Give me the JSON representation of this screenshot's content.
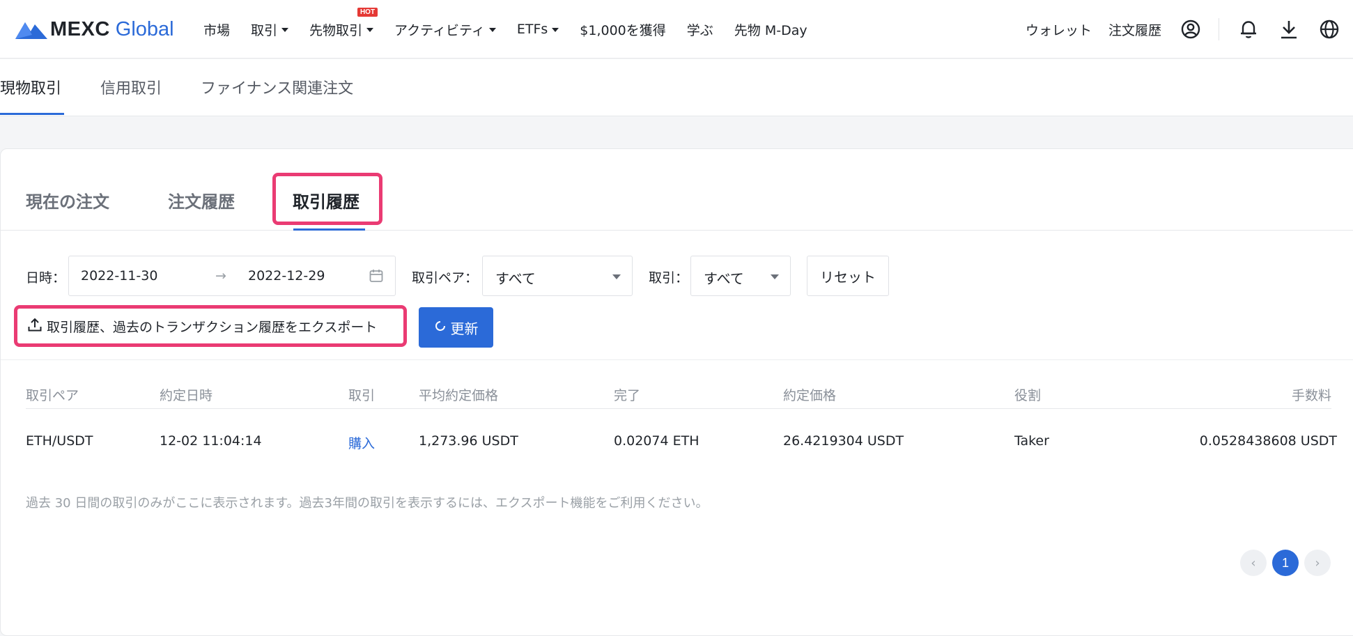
{
  "brand": {
    "name": "MEXC",
    "suffix": "Global"
  },
  "nav": {
    "items": [
      {
        "label": "市場"
      },
      {
        "label": "取引"
      },
      {
        "label": "先物取引",
        "badge": "HOT"
      },
      {
        "label": "アクティビティ"
      },
      {
        "label": "ETFs"
      },
      {
        "label": "$1,000を獲得"
      },
      {
        "label": "学ぶ"
      },
      {
        "label": "先物 M-Day"
      }
    ],
    "right": {
      "wallet": "ウォレット",
      "orders": "注文履歴"
    },
    "icons": [
      "user-icon",
      "bell-icon",
      "download-icon",
      "globe-icon"
    ]
  },
  "subtabs": [
    "現物取引",
    "信用取引",
    "ファイナンス関連注文"
  ],
  "tabs": [
    "現在の注文",
    "注文履歴",
    "取引履歴"
  ],
  "filters": {
    "date_label": "日時：",
    "date_from": "2022-11-30",
    "date_arrow": "→",
    "date_to": "2022-12-29",
    "pair_label": "取引ペア：",
    "pair_value": "すべて",
    "side_label": "取引：",
    "side_value": "すべて",
    "reset": "リセット"
  },
  "actions": {
    "export": "取引履歴、過去のトランザクション履歴をエクスポート",
    "refresh": "更新"
  },
  "table": {
    "headers": [
      "取引ペア",
      "約定日時",
      "取引",
      "平均約定価格",
      "完了",
      "約定価格",
      "役割",
      "手数料"
    ],
    "rows": [
      [
        "ETH/USDT",
        "12-02 11:04:14",
        "購入",
        "1,273.96 USDT",
        "0.02074 ETH",
        "26.4219304 USDT",
        "Taker",
        "0.0528438608 USDT"
      ]
    ]
  },
  "note": "過去 30 日間の取引のみがここに表示されます。過去3年間の取引を表示するには、エクスポート機能をご利用ください。",
  "pagination": {
    "prev": "‹",
    "current": "1",
    "next": "›"
  },
  "colors": {
    "accent": "#2b6ad8",
    "highlight": "#ea3b73"
  }
}
